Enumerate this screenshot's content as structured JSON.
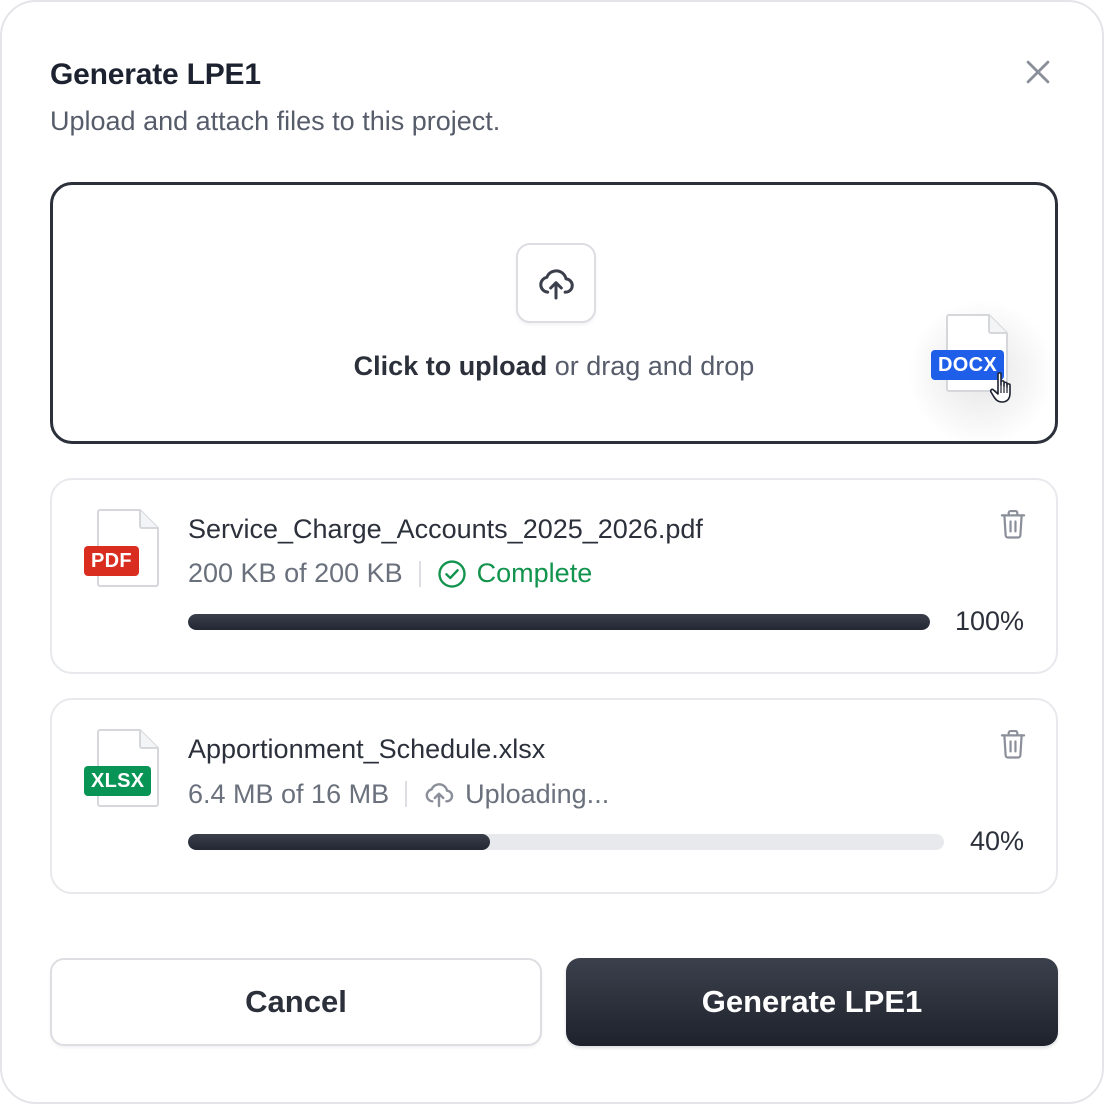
{
  "dialog": {
    "title": "Generate LPE1",
    "subtitle": "Upload and attach files to this project."
  },
  "dropzone": {
    "cta_strong": "Click to upload",
    "cta_rest": " or drag and drop",
    "dragging_file_badge": "DOCX",
    "dragging_badge_color": "#1f5ee8"
  },
  "files": [
    {
      "name": "Service_Charge_Accounts_2025_2026.pdf",
      "type_badge": "PDF",
      "badge_color": "#d92d20",
      "size_text": "200 KB of 200 KB",
      "status": "Complete",
      "status_icon": "check-circle-icon",
      "progress": 1.0,
      "percent_text": "100%"
    },
    {
      "name": "Apportionment_Schedule.xlsx",
      "type_badge": "XLSX",
      "badge_color": "#079455",
      "size_text": "6.4 MB of 16 MB",
      "status": "Uploading...",
      "status_icon": "upload-cloud-icon",
      "progress": 0.4,
      "percent_text": "40%"
    }
  ],
  "footer": {
    "cancel_label": "Cancel",
    "primary_label": "Generate LPE1"
  }
}
